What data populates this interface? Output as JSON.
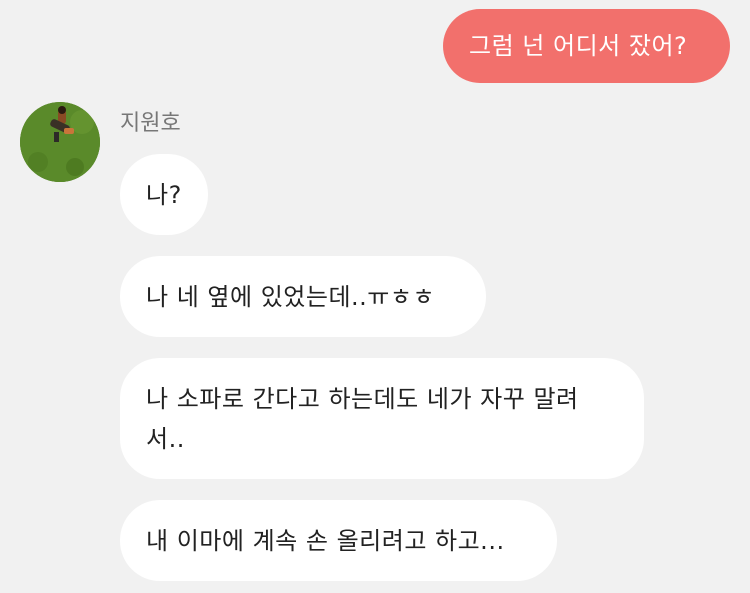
{
  "chat": {
    "outgoing": [
      {
        "text": "그럼 넌 어디서 잤어?"
      }
    ],
    "sender": {
      "name": "지원호",
      "avatar_icon": "profile-photo-person-on-grass"
    },
    "incoming": [
      {
        "text": "나?"
      },
      {
        "text": "나 네 옆에 있었는데..ㅠㅎㅎ"
      },
      {
        "text_line1": "나 소파로 간다고 하는데도 네가 자꾸 말려",
        "text_line2": "서.."
      },
      {
        "text": "내 이마에 계속 손 올리려고 하고..."
      }
    ]
  },
  "colors": {
    "background": "#f1f1f1",
    "outgoing_bubble": "#f2706c",
    "incoming_bubble": "#ffffff",
    "sender_name": "#777777"
  }
}
